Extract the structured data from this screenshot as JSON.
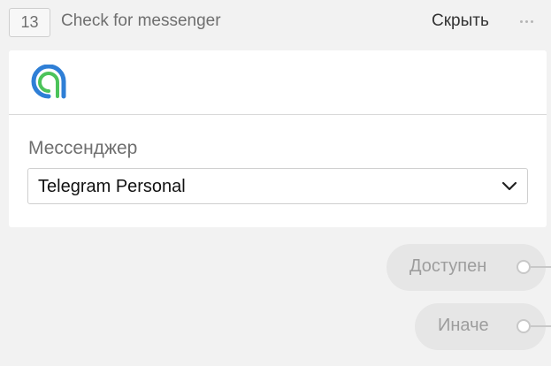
{
  "header": {
    "step_number": "13",
    "title": "Check for messenger",
    "hide_label": "Скрыть"
  },
  "card": {
    "logo_colors": {
      "outer": "#2f7fd6",
      "inner": "#4cc35a"
    },
    "field_label": "Мессенджер",
    "messenger_select": {
      "value": "Telegram Personal"
    }
  },
  "outputs": [
    {
      "label": "Доступен"
    },
    {
      "label": "Иначе"
    }
  ],
  "icons": {
    "more": "more-horizontal-icon",
    "chevron": "chevron-down-icon",
    "logo": "app-logo-icon"
  }
}
